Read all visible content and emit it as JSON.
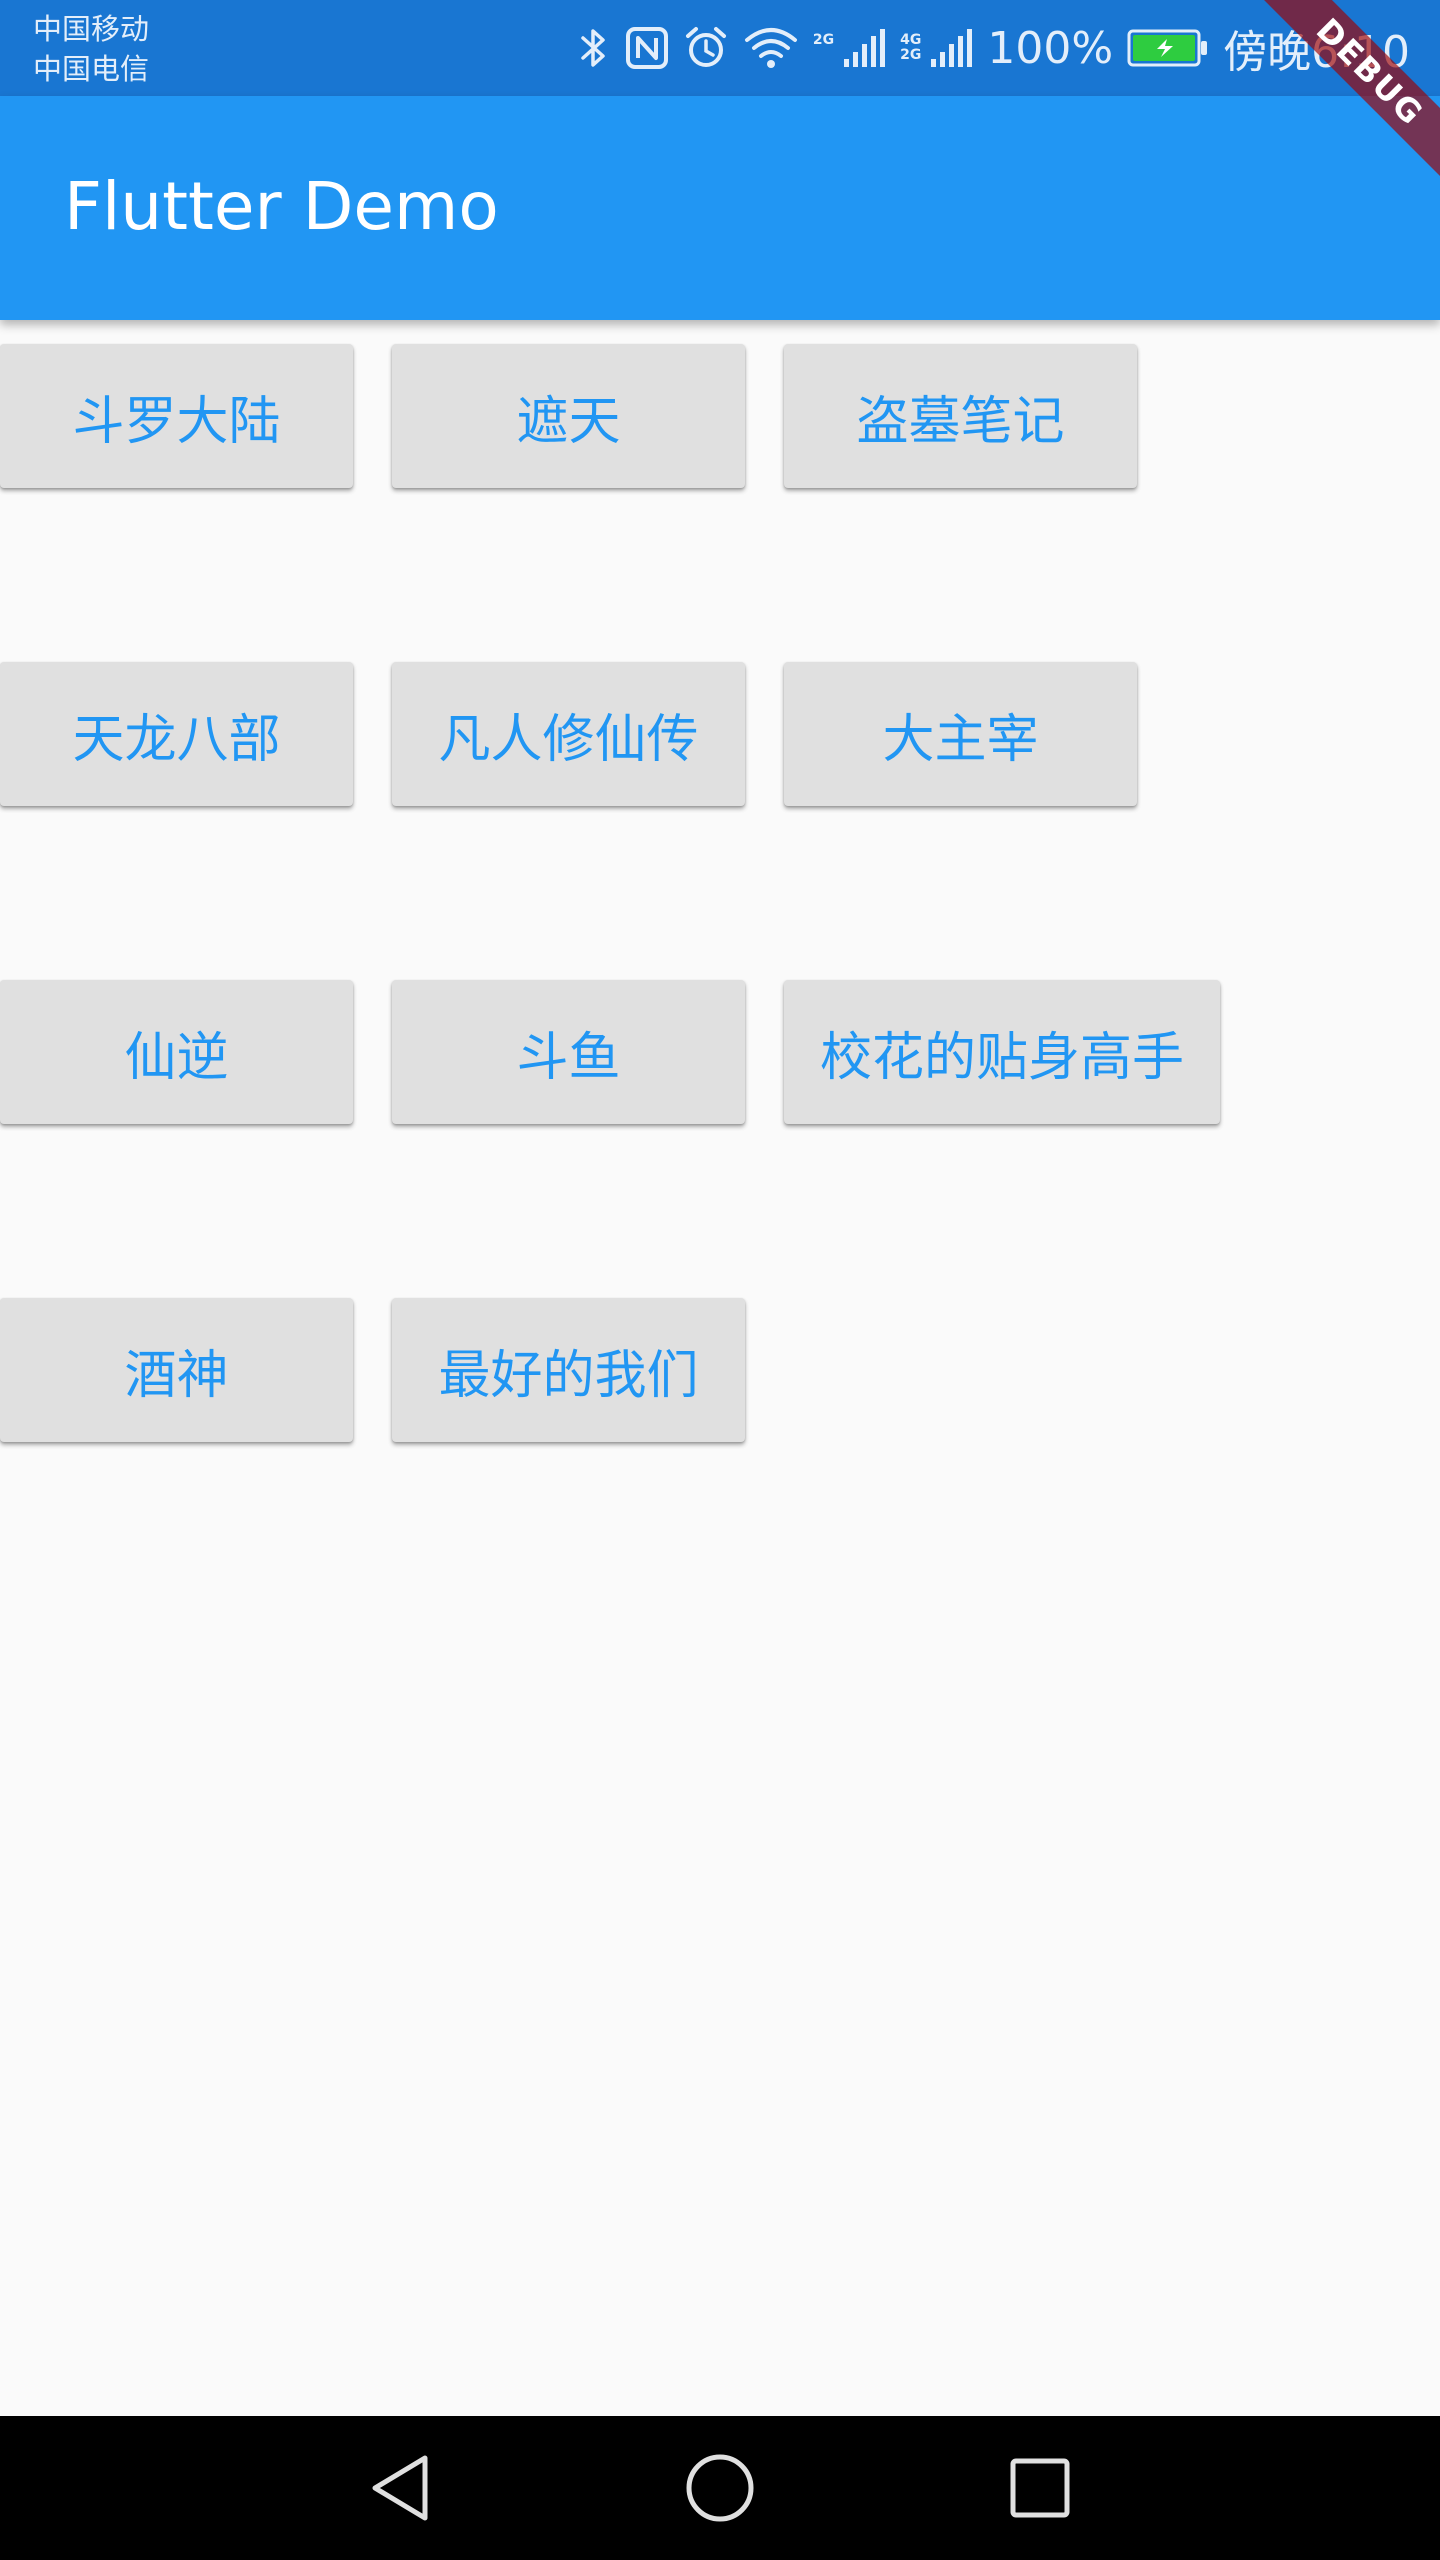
{
  "status_bar": {
    "carrier_1": "中国移动",
    "carrier_2": "中国电信",
    "net_1_label": "2G",
    "net_2_top": "4G",
    "net_2_bottom": "2G",
    "battery_percent": "100%",
    "time": "傍晚6:10",
    "icons": [
      "bluetooth-icon",
      "nfc-icon",
      "alarm-icon",
      "wifi-icon",
      "signal-icon",
      "signal-icon",
      "battery-charging-icon"
    ]
  },
  "app_bar": {
    "title": "Flutter Demo"
  },
  "debug_banner": "DEBUG",
  "buttons": [
    "斗罗大陆",
    "遮天",
    "盗墓笔记",
    "天龙八部",
    "凡人修仙传",
    "大主宰",
    "仙逆",
    "斗鱼",
    "校花的贴身高手",
    "酒神",
    "最好的我们"
  ],
  "colors": {
    "status_bar": "#1976D2",
    "app_bar": "#2196F3",
    "button_bg": "#E0E0E0",
    "button_text": "#2196F3",
    "background": "#FAFAFA",
    "nav_bar": "#000000"
  },
  "nav_bar": {
    "icons": [
      "back-icon",
      "home-icon",
      "recents-icon"
    ]
  }
}
